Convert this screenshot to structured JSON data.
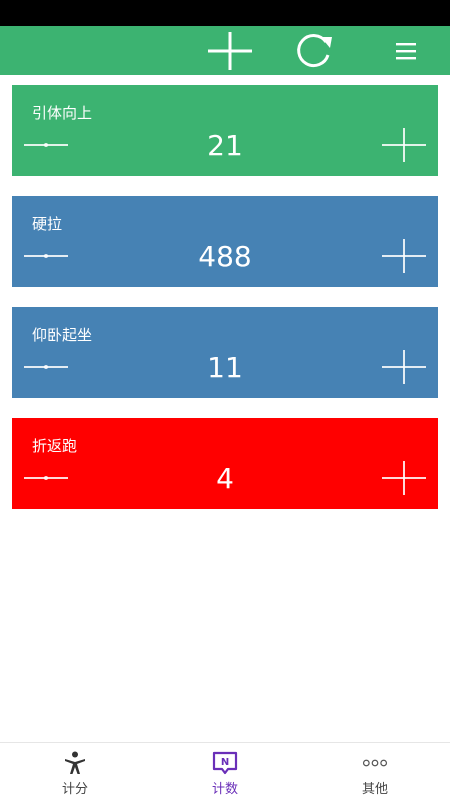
{
  "colors": {
    "toolbar": "#3cb371",
    "active_nav": "#6a2fb8"
  },
  "toolbar": {
    "icons": [
      "plus-icon",
      "refresh-icon",
      "menu-icon"
    ]
  },
  "counters": [
    {
      "title": "引体向上",
      "value": "21",
      "color": "#3cb371"
    },
    {
      "title": "硬拉",
      "value": "488",
      "color": "#4682b4"
    },
    {
      "title": "仰卧起坐",
      "value": "11",
      "color": "#4682b4"
    },
    {
      "title": "折返跑",
      "value": "4",
      "color": "#ff0000"
    }
  ],
  "bottom_nav": {
    "items": [
      {
        "label": "计分",
        "icon": "person-icon"
      },
      {
        "label": "计数",
        "icon": "counter-icon",
        "active": true
      },
      {
        "label": "其他",
        "icon": "more-icon"
      }
    ]
  }
}
